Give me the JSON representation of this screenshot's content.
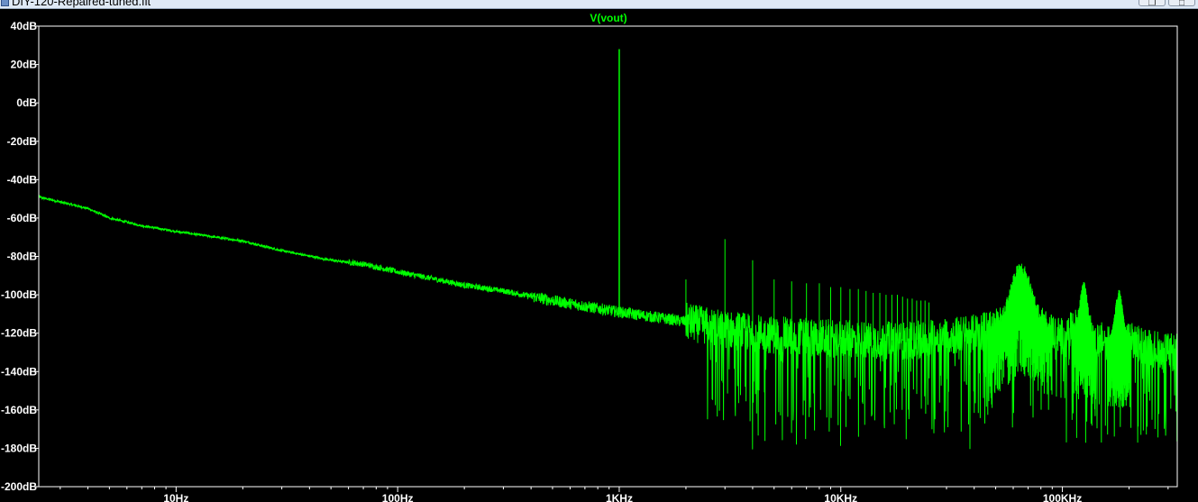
{
  "window": {
    "title": "DIY-120-Repaired-tuned.flt",
    "restore_symbol": "❐",
    "second_button_symbol": "□"
  },
  "chart_data": {
    "type": "line",
    "title": "V(vout)",
    "xlabel": "",
    "ylabel": "",
    "x_scale": "log",
    "xlim": [
      2.4,
      330000
    ],
    "ylim": [
      -200,
      40
    ],
    "x_ticks": [
      10,
      100,
      1000,
      10000,
      100000
    ],
    "x_tick_labels": [
      "10Hz",
      "100Hz",
      "1KHz",
      "10KHz",
      "100KHz"
    ],
    "y_ticks": [
      40,
      20,
      0,
      -20,
      -40,
      -60,
      -80,
      -100,
      -120,
      -140,
      -160,
      -180,
      -200
    ],
    "y_tick_labels": [
      "40dB",
      "20dB",
      "0dB",
      "-20dB",
      "-40dB",
      "-60dB",
      "-80dB",
      "-100dB",
      "-120dB",
      "-140dB",
      "-160dB",
      "-180dB",
      "-200dB"
    ],
    "grid": false,
    "background": "#000000",
    "axis_color": "#ffffff",
    "label_color": "#ffffff",
    "series": [
      {
        "name": "V(vout)",
        "color": "#00ff00",
        "noise_floor": {
          "x": [
            2.4,
            4,
            5,
            7,
            10,
            20,
            30,
            50,
            70,
            100,
            150,
            200,
            300,
            500,
            700,
            1000,
            2000,
            3000,
            5000,
            10000,
            20000,
            40000,
            55000,
            65000,
            75000,
            100000,
            120000,
            150000,
            200000,
            300000,
            330000
          ],
          "y": [
            -49,
            -55,
            -60,
            -64,
            -67,
            -72,
            -77,
            -82,
            -84,
            -88,
            -92,
            -95,
            -98,
            -103,
            -106,
            -109,
            -114,
            -118,
            -121,
            -123,
            -124,
            -120,
            -115,
            -106,
            -114,
            -122,
            -116,
            -124,
            -124,
            -130,
            -130
          ]
        },
        "spikes": {
          "x": [
            1000,
            2000,
            3000,
            4000,
            5000,
            6000,
            7000,
            8000,
            9000,
            10000,
            11000,
            12000,
            13000,
            14000,
            15000,
            16000,
            17000,
            18000,
            19000,
            20000,
            21000,
            22000,
            23000,
            24000,
            25000
          ],
          "y": [
            28,
            -92,
            -71,
            -82,
            -92,
            -93,
            -94,
            -94,
            -96,
            -96,
            -97,
            -97,
            -98,
            -99,
            -99,
            -100,
            -100,
            -100,
            -101,
            -102,
            -102,
            -103,
            -103,
            -103,
            -104
          ]
        },
        "resonance_peaks": {
          "x": [
            65000,
            125000,
            180000
          ],
          "y": [
            -86,
            -96,
            -100
          ]
        }
      }
    ]
  }
}
